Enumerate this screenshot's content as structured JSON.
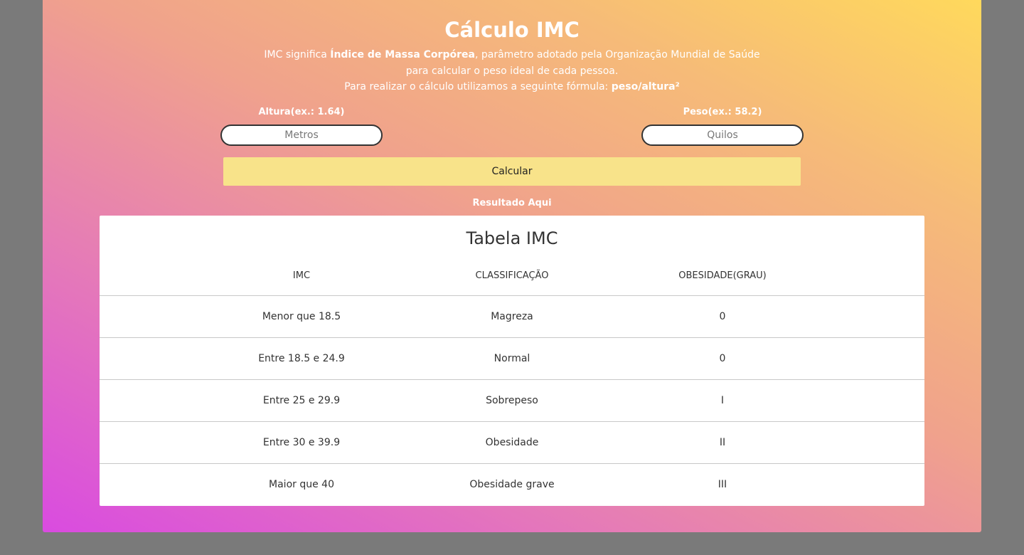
{
  "page": {
    "title": "Cálculo IMC",
    "intro_line1_prefix": "IMC significa ",
    "intro_line1_bold": "Índice de Massa Corpórea",
    "intro_line1_suffix": ", parâmetro adotado pela Organização Mundial de Saúde",
    "intro_line2": "para calcular o peso ideal de cada pessoa.",
    "intro_line3_prefix": "Para realizar o cálculo utilizamos a seguinte fórmula: ",
    "intro_line3_bold": "peso/altura²"
  },
  "form": {
    "height_label": "Altura(ex.: 1.64)",
    "height_placeholder": "Metros",
    "weight_label": "Peso(ex.: 58.2)",
    "weight_placeholder": "Quilos",
    "calculate_label": "Calcular",
    "result_text": "Resultado Aqui"
  },
  "table": {
    "title": "Tabela IMC",
    "headers": [
      "IMC",
      "CLASSIFICAÇÃO",
      "OBESIDADE(GRAU)"
    ],
    "rows": [
      [
        "Menor que 18.5",
        "Magreza",
        "0"
      ],
      [
        "Entre 18.5 e 24.9",
        "Normal",
        "0"
      ],
      [
        "Entre 25 e 29.9",
        "Sobrepeso",
        "I"
      ],
      [
        "Entre 30 e 39.9",
        "Obesidade",
        "II"
      ],
      [
        "Maior que 40",
        "Obesidade grave",
        "III"
      ]
    ]
  },
  "colors": {
    "page_background": "#7a7a7a",
    "gradient_start": "#d94be0",
    "gradient_end": "#ffd95c",
    "button": "#f8e38a"
  }
}
